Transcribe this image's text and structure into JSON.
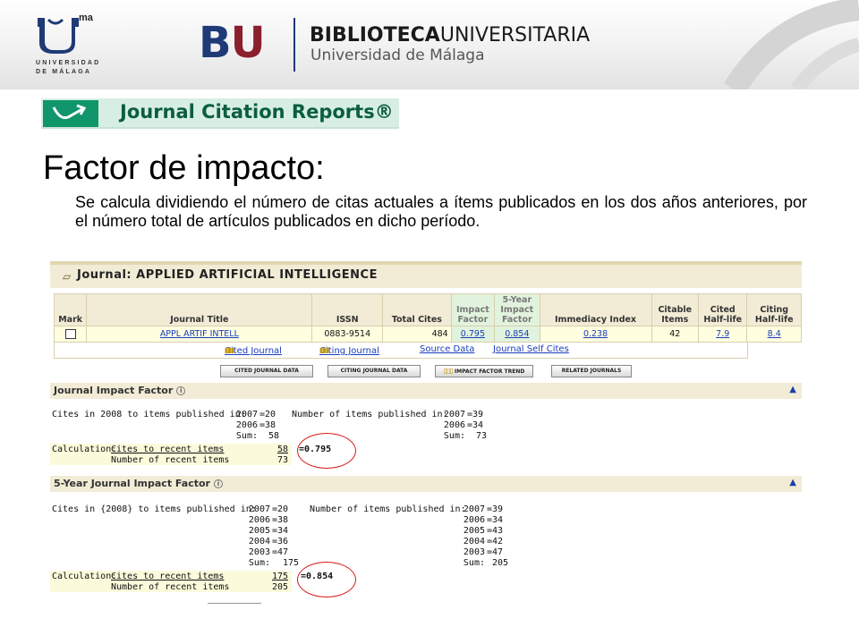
{
  "header": {
    "uma": {
      "ma": "ma",
      "line1": "UNIVERSIDAD",
      "line2": "DE MÁLAGA"
    },
    "bu_logo": {
      "b": "B",
      "u": "U"
    },
    "bib_bold": "BIBLIOTECA",
    "bib_light": "UNIVERSITARIA",
    "subtitle": "Universidad de Málaga"
  },
  "jcr_logo": "Journal Citation Reports®",
  "slide": {
    "heading": "Factor de impacto:",
    "paragraph": "Se calcula dividiendo el número de citas actuales a ítems publicados en los dos años anteriores, por el número total de artículos publicados en dicho período."
  },
  "journal": {
    "title": "Journal: APPLIED ARTIFICIAL INTELLIGENCE",
    "columns": [
      "Mark",
      "Journal Title",
      "ISSN",
      "Total Cites",
      "Impact Factor",
      "5-Year Impact Factor",
      "Immediacy Index",
      "Citable Items",
      "Cited Half-life",
      "Citing Half-life"
    ],
    "row": {
      "title": "APPL ARTIF INTELL",
      "issn": "0883-9514",
      "total_cites": "484",
      "impact_factor": "0.795",
      "five_year_if": "0.854",
      "immediacy": "0.238",
      "citable": "42",
      "cited_half": "7.9",
      "citing_half": "8.4"
    },
    "links": [
      "Cited Journal",
      "Citing Journal",
      "Source Data",
      "Journal Self Cites"
    ],
    "buttons": [
      "CITED JOURNAL DATA",
      "CITING JOURNAL DATA",
      "IMPACT FACTOR TREND",
      "RELATED JOURNALS"
    ],
    "colors": {
      "header_bg": "#f2ecd6",
      "row_bg": "#ffffe0",
      "highlight": "#e2f3dd",
      "link": "#1a3dbd",
      "oval": "#d81818"
    }
  },
  "jif": {
    "title": "Journal Impact Factor",
    "cites_label": "Cites in 2008 to items published in:",
    "cites": [
      {
        "year": "2007",
        "value": "=20"
      },
      {
        "year": "2006",
        "value": "=38"
      },
      {
        "year": "Sum:",
        "value": "58"
      }
    ],
    "items_label": "Number of items published in:",
    "items": [
      {
        "year": "2007",
        "value": "=39"
      },
      {
        "year": "2006",
        "value": "=34"
      },
      {
        "year": "Sum:",
        "value": "73"
      }
    ],
    "calc_label": "Calculation:",
    "calc_top": "Cites to recent items",
    "calc_bottom": "Number of recent items",
    "num": "58",
    "den": "73",
    "result": "=0.795"
  },
  "fiveyear": {
    "title": "5-Year Journal Impact Factor",
    "cites_label": "Cites in {2008} to items published in:",
    "cites": [
      {
        "year": "2007",
        "value": "=20"
      },
      {
        "year": "2006",
        "value": "=38"
      },
      {
        "year": "2005",
        "value": "=34"
      },
      {
        "year": "2004",
        "value": "=36"
      },
      {
        "year": "2003",
        "value": "=47"
      },
      {
        "year": "Sum:",
        "value": "175"
      }
    ],
    "items_label": "Number of items published in:",
    "items": [
      {
        "year": "2007",
        "value": "=39"
      },
      {
        "year": "2006",
        "value": "=34"
      },
      {
        "year": "2005",
        "value": "=43"
      },
      {
        "year": "2004",
        "value": "=42"
      },
      {
        "year": "2003",
        "value": "=47"
      },
      {
        "year": "Sum:",
        "value": "205"
      }
    ],
    "calc_label": "Calculation:",
    "calc_top": "Cites to recent items",
    "calc_bottom": "Number of recent items",
    "num": "175",
    "den": "205",
    "result": "=0.854"
  }
}
